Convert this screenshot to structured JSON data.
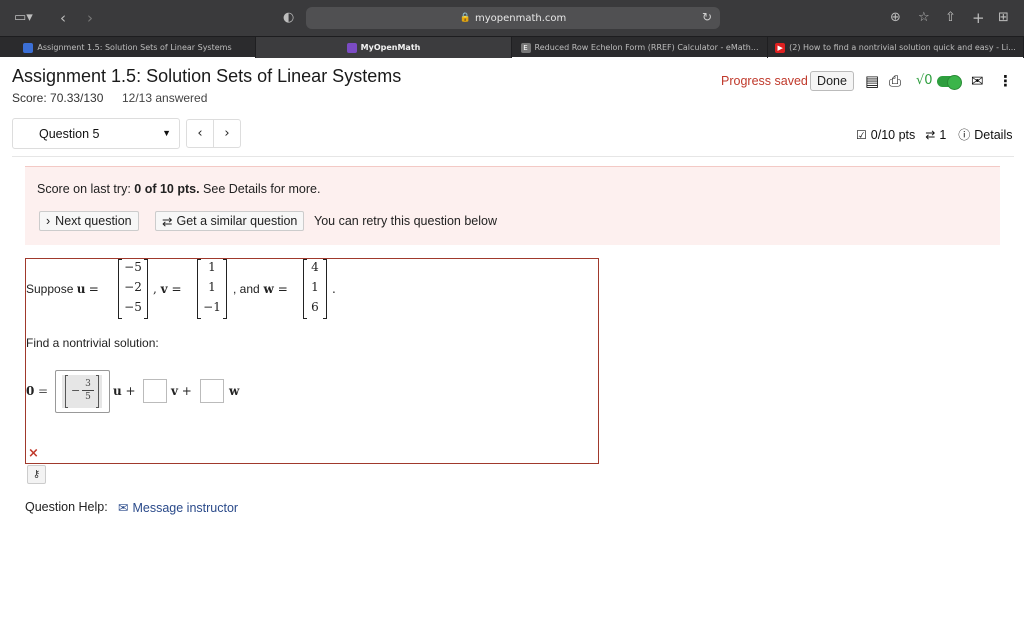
{
  "browser": {
    "url": "myopenmath.com",
    "tabs": [
      {
        "label": "Assignment 1.5: Solution Sets of Linear Systems",
        "icon": "mom-icon"
      },
      {
        "label": "MyOpenMath",
        "icon": "mom-icon"
      },
      {
        "label": "Reduced Row Echelon Form (RREF) Calculator - eMath...",
        "icon": "e-icon"
      },
      {
        "label": "(2) How to find a nontrivial solution quick and easy - Li...",
        "icon": "youtube-icon"
      }
    ]
  },
  "header": {
    "title": "Assignment 1.5: Solution Sets of Linear Systems",
    "score": "Score: 70.33/130",
    "answered": "12/13 answered",
    "progress": "Progress saved",
    "done": "Done",
    "sqrt_label": "√0"
  },
  "nav": {
    "question": "Question 5",
    "prev": "‹",
    "next": "›",
    "points": "0/10 pts",
    "retries": "1",
    "details": "Details"
  },
  "feedback": {
    "prefix": "Score on last try: ",
    "score_bold": "0 of 10 pts.",
    "suffix": " See Details for more.",
    "next_question": "Next question",
    "similar_question": "Get a similar question",
    "retry_text": "You can retry this question below"
  },
  "question": {
    "suppose": "Suppose",
    "u_label": "u",
    "v_label": "v",
    "w_label": "w",
    "and_text": ", and",
    "u": [
      "−5",
      "−2",
      "−5"
    ],
    "v": [
      "1",
      "1",
      "−1"
    ],
    "w": [
      "4",
      "1",
      "6"
    ],
    "find_text": "Find a nontrivial solution:",
    "zero": "0",
    "answer_u": {
      "sign": "−",
      "num": "3",
      "den": "5"
    },
    "answer_v": "",
    "answer_w": ""
  },
  "help": {
    "label": "Question Help:",
    "message": "Message instructor"
  },
  "colors": {
    "accent_red": "#c0392b",
    "link_blue": "#2a4a8a",
    "toggle_green": "#2e9e3e"
  }
}
